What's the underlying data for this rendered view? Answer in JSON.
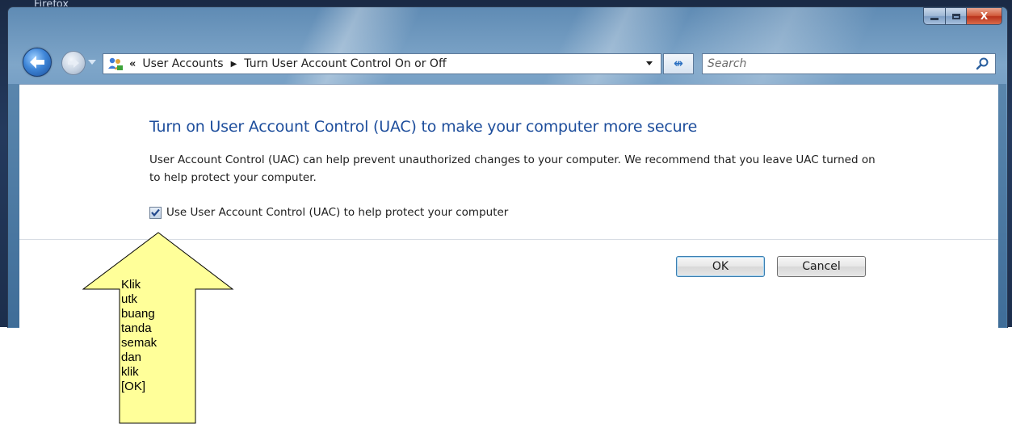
{
  "desktop": {
    "caption": "Firefox"
  },
  "window": {
    "caption_buttons": {
      "minimize": "minimize",
      "maximize": "maximize",
      "close": "X"
    }
  },
  "nav": {
    "back_icon": "back-arrow-icon",
    "forward_icon": "forward-arrow-icon",
    "overflow": "«",
    "breadcrumb": [
      "User Accounts",
      "Turn User Account Control On or Off"
    ],
    "search_placeholder": "Search"
  },
  "content": {
    "heading": "Turn on User Account Control (UAC) to make your computer more secure",
    "description": "User Account Control (UAC) can help prevent unauthorized changes to your computer.  We recommend that you leave UAC turned on to help protect your computer.",
    "checkbox_label": "Use User Account Control (UAC) to help protect your computer",
    "checkbox_checked": true,
    "ok_label": "OK",
    "cancel_label": "Cancel"
  },
  "callout": {
    "text": "Klik utk buang tanda semak dan klik [OK]",
    "fill_color": "#ffff99"
  },
  "colors": {
    "heading": "#1e4e9c",
    "frame": "#5f8bb4",
    "close_button": "#c7432a"
  }
}
